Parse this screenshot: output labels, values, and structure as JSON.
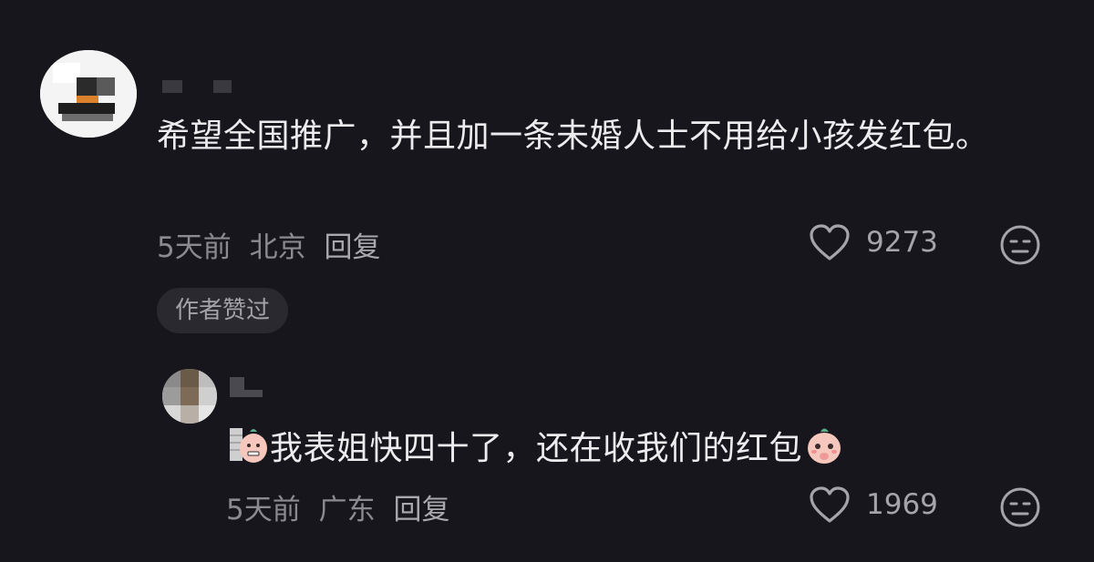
{
  "comment1": {
    "text": "希望全国推广，并且加一条未婚人士不用给小孩发红包。",
    "time": "5天前",
    "location": "北京",
    "reply_label": "回复",
    "likes": "9273",
    "badge": "作者赞过"
  },
  "reply1": {
    "text": "我表姐快四十了，还在收我们的红包",
    "time": "5天前",
    "location": "广东",
    "reply_label": "回复",
    "likes": "1969"
  },
  "icons": {
    "like": "heart-outline-icon",
    "dislike": "meh-face-icon"
  },
  "colors": {
    "background": "#17161c",
    "text": "#ececee",
    "meta": "#8b8a90",
    "badge_bg": "#2a292f"
  }
}
